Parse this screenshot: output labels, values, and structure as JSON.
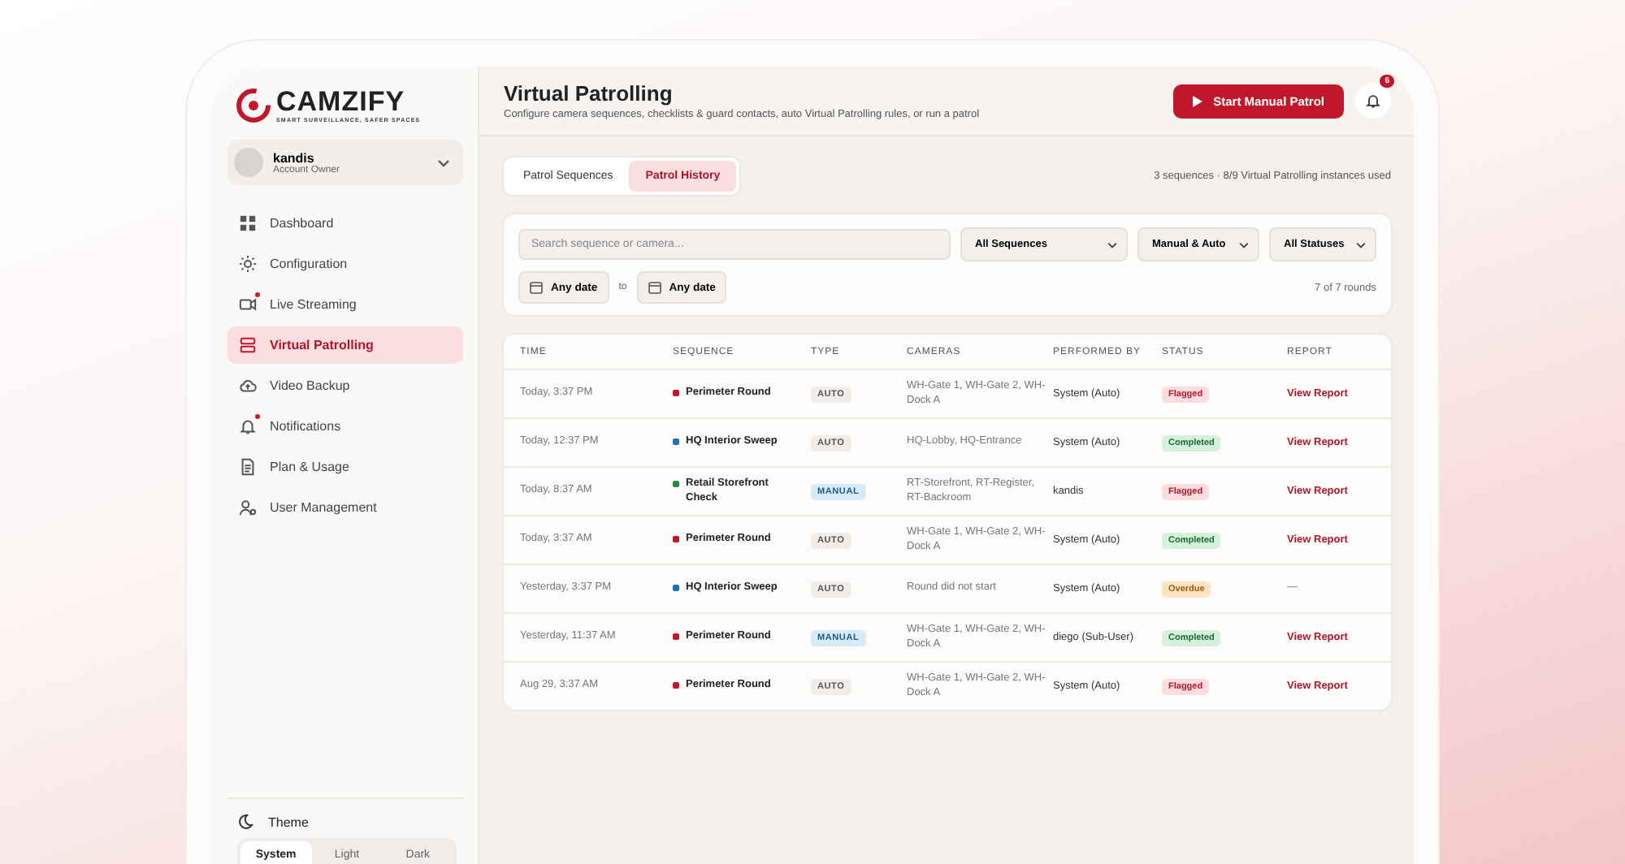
{
  "brand": {
    "name": "CAMZIFY",
    "tagline": "SMART SURVEILLANCE, SAFER SPACES"
  },
  "user": {
    "name": "kandis",
    "role": "Account Owner"
  },
  "nav": [
    {
      "label": "Dashboard",
      "selected": false,
      "alert": false
    },
    {
      "label": "Configuration",
      "selected": false,
      "alert": false
    },
    {
      "label": "Live Streaming",
      "selected": false,
      "alert": true
    },
    {
      "label": "Virtual Patrolling",
      "selected": true,
      "alert": false
    },
    {
      "label": "Video Backup",
      "selected": false,
      "alert": false
    },
    {
      "label": "Notifications",
      "selected": false,
      "alert": true
    },
    {
      "label": "Plan & Usage",
      "selected": false,
      "alert": false
    },
    {
      "label": "User Management",
      "selected": false,
      "alert": false
    }
  ],
  "theme": {
    "label": "Theme",
    "options": [
      {
        "label": "System",
        "selected": true
      },
      {
        "label": "Light",
        "selected": false
      },
      {
        "label": "Dark",
        "selected": false
      }
    ]
  },
  "header": {
    "title": "Virtual Patrolling",
    "subtitle": "Configure camera sequences, checklists & guard contacts, auto Virtual Patrolling rules, or run a patrol",
    "action": "Start Manual Patrol",
    "notification_count": "6"
  },
  "tabs": [
    {
      "label": "Patrol Sequences",
      "selected": false
    },
    {
      "label": "Patrol History",
      "selected": true
    }
  ],
  "usage": "3 sequences · 8/9 Virtual Patrolling instances used",
  "filters": {
    "search_placeholder": "Search sequence or camera...",
    "selects": [
      "All Sequences",
      "Manual & Auto",
      "All Statuses"
    ],
    "date_from": "Any date",
    "date_sep": "to",
    "date_to": "Any date",
    "count": "7 of 7 rounds"
  },
  "table": {
    "columns": [
      "TIME",
      "SEQUENCE",
      "TYPE",
      "CAMERAS",
      "PERFORMED BY",
      "STATUS",
      "REPORT"
    ],
    "rows": [
      {
        "time": "Today, 3:37 PM",
        "sequence": "Perimeter Round",
        "color": "#c0182a",
        "type": "AUTO",
        "cameras": "WH-Gate 1, WH-Gate 2, WH-Dock A",
        "by": "System (Auto)",
        "status": "Flagged",
        "report": "View Report"
      },
      {
        "time": "Today, 12:37 PM",
        "sequence": "HQ Interior Sweep",
        "color": "#1f6fb2",
        "type": "AUTO",
        "cameras": "HQ-Lobby, HQ-Entrance",
        "by": "System (Auto)",
        "status": "Completed",
        "report": "View Report"
      },
      {
        "time": "Today, 8:37 AM",
        "sequence": "Retail Storefront Check",
        "color": "#2e8b3e",
        "type": "MANUAL",
        "cameras": "RT-Storefront, RT-Register, RT-Backroom",
        "by": "kandis",
        "status": "Flagged",
        "report": "View Report"
      },
      {
        "time": "Today, 3:37 AM",
        "sequence": "Perimeter Round",
        "color": "#c0182a",
        "type": "AUTO",
        "cameras": "WH-Gate 1, WH-Gate 2, WH-Dock A",
        "by": "System (Auto)",
        "status": "Completed",
        "report": "View Report"
      },
      {
        "time": "Yesterday, 3:37 PM",
        "sequence": "HQ Interior Sweep",
        "color": "#1f6fb2",
        "type": "AUTO",
        "cameras": "Round did not start",
        "by": "System (Auto)",
        "status": "Overdue",
        "report": "—"
      },
      {
        "time": "Yesterday, 11:37 AM",
        "sequence": "Perimeter Round",
        "color": "#c0182a",
        "type": "MANUAL",
        "cameras": "WH-Gate 1, WH-Gate 2, WH-Dock A",
        "by": "diego (Sub-User)",
        "status": "Completed",
        "report": "View Report"
      },
      {
        "time": "Aug 29, 3:37 AM",
        "sequence": "Perimeter Round",
        "color": "#c0182a",
        "type": "AUTO",
        "cameras": "WH-Gate 1, WH-Gate 2, WH-Dock A",
        "by": "System (Auto)",
        "status": "Flagged",
        "report": "View Report"
      }
    ]
  }
}
